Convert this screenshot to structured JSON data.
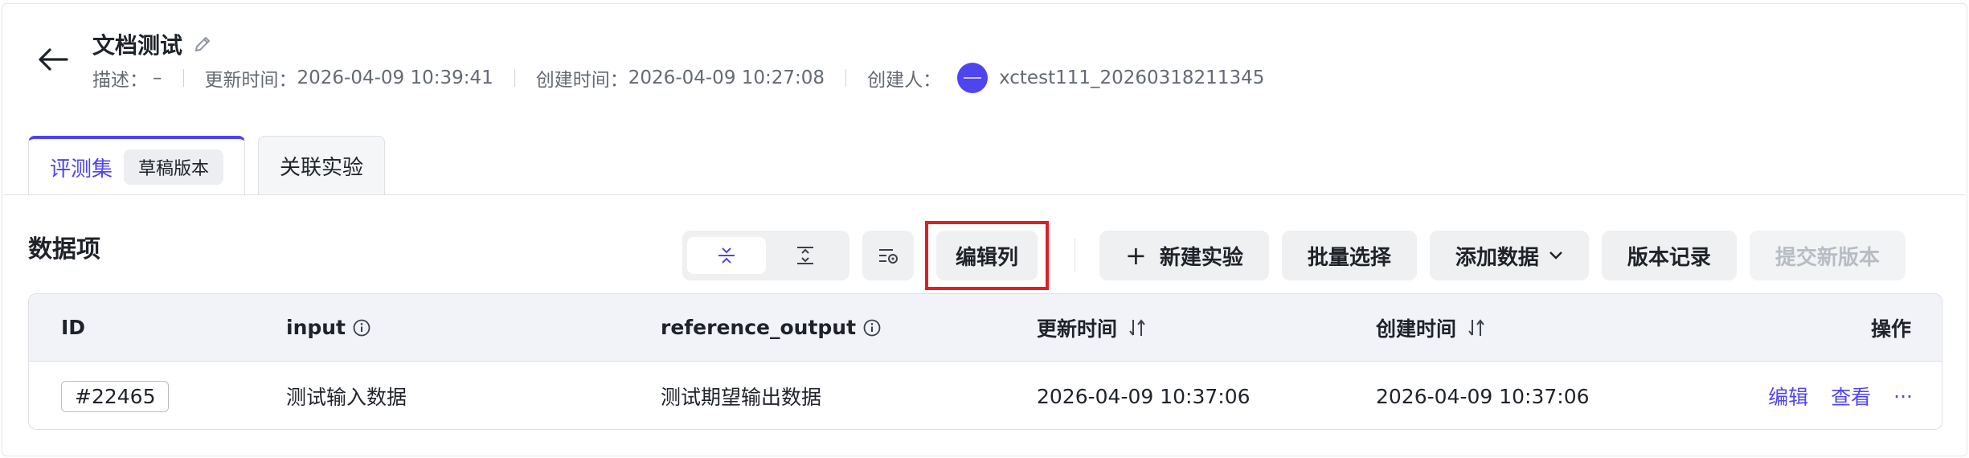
{
  "header": {
    "title": "文档测试",
    "desc_label": "描述：",
    "desc_value": "–",
    "updated_label": "更新时间：",
    "updated_value": "2026-04-09 10:39:41",
    "created_label": "创建时间：",
    "created_value": "2026-04-09 10:27:08",
    "creator_label": "创建人：",
    "creator_name": "xctest111_20260318211345"
  },
  "tabs": [
    {
      "label": "评测集",
      "badge": "草稿版本",
      "active": true
    },
    {
      "label": "关联实验",
      "active": false
    }
  ],
  "section": {
    "title": "数据项"
  },
  "toolbar": {
    "edit_columns": "编辑列",
    "new_experiment": "新建实验",
    "batch_select": "批量选择",
    "add_data": "添加数据",
    "version_history": "版本记录",
    "submit_version": "提交新版本"
  },
  "table": {
    "headers": {
      "id": "ID",
      "input": "input",
      "reference_output": "reference_output",
      "updated_at": "更新时间",
      "created_at": "创建时间",
      "actions": "操作"
    },
    "rows": [
      {
        "id": "#22465",
        "input": "测试输入数据",
        "reference_output": "测试期望输出数据",
        "updated_at": "2026-04-09 10:37:06",
        "created_at": "2026-04-09 10:37:06",
        "edit": "编辑",
        "view": "查看",
        "more": "···"
      }
    ]
  },
  "colors": {
    "accent": "#4e44f0",
    "highlight_border": "#e51c23",
    "muted_text": "#646a73"
  },
  "icons": {
    "back": "arrow-left-icon",
    "edit_title": "pencil-icon",
    "collapse": "compress-icon",
    "expand": "expand-icon",
    "filter": "filter-settings-icon",
    "info": "info-icon",
    "sort": "sort-icon",
    "caret": "chevron-down-icon"
  }
}
